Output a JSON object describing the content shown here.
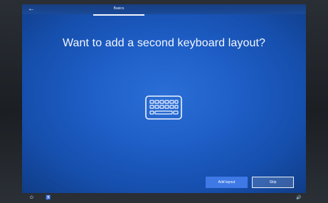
{
  "header": {
    "tab_label": "Basics",
    "back_icon": "back-arrow-icon"
  },
  "main": {
    "title": "Want to add a second keyboard layout?",
    "icon": "keyboard-icon"
  },
  "actions": {
    "add_layout_label": "Add layout",
    "skip_label": "Skip"
  },
  "footer": {
    "left_icons": [
      "power-icon",
      "accessibility-icon"
    ],
    "right_icon": "volume-icon"
  },
  "colors": {
    "background": "#1f5fc8",
    "primary_button": "#3f79e6",
    "text": "#f3f7ff"
  }
}
